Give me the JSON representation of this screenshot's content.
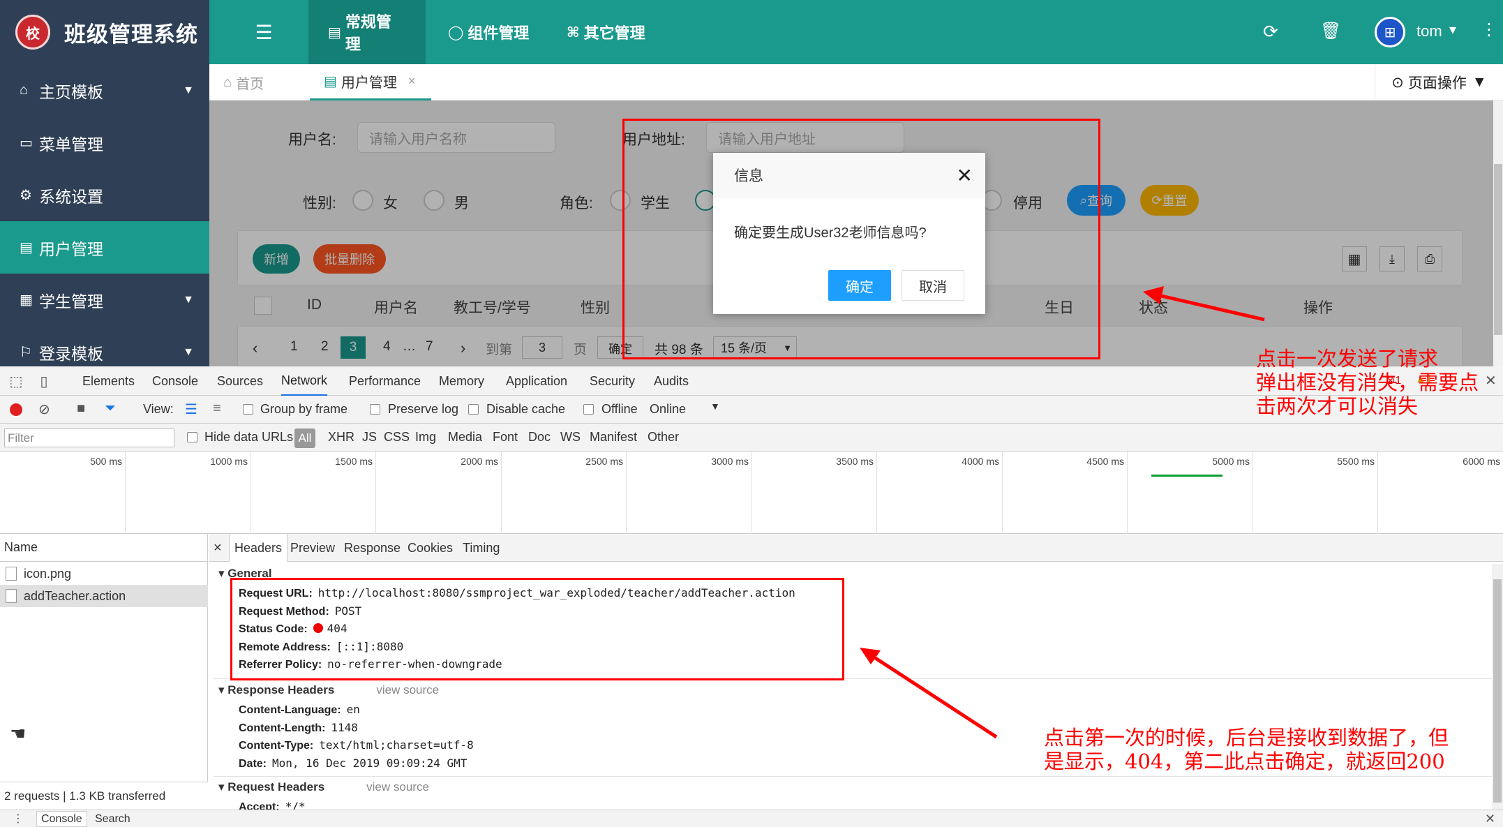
{
  "app": {
    "title": "班级管理系统",
    "logo_text": "校"
  },
  "topnav": [
    {
      "label": "常规管理",
      "icon": "file-icon"
    },
    {
      "label": "组件管理",
      "icon": "lemon-icon"
    },
    {
      "label": "其它管理",
      "icon": "slideshare-icon"
    }
  ],
  "topright": {
    "user": "tom"
  },
  "sidebar": [
    {
      "label": "主页模板",
      "icon": "home-icon"
    },
    {
      "label": "菜单管理",
      "icon": "window-icon"
    },
    {
      "label": "系统设置",
      "icon": "gears-icon"
    },
    {
      "label": "用户管理",
      "icon": "file-icon"
    },
    {
      "label": "学生管理",
      "icon": "calendar-icon"
    },
    {
      "label": "登录模板",
      "icon": "flag-icon"
    }
  ],
  "tabs": {
    "home": "首页",
    "users": "用户管理",
    "page_ops": "页面操作"
  },
  "search": {
    "username_label": "用户名:",
    "username_placeholder": "请输入用户名称",
    "address_label": "用户地址:",
    "address_placeholder": "请输入用户地址",
    "gender_label": "性别:",
    "female": "女",
    "male": "男",
    "role_label": "角色:",
    "student": "学生",
    "disabled": "停用",
    "query_btn": "查询",
    "reset_btn": "重置"
  },
  "table_toolbar": {
    "add": "新增",
    "batch_delete": "批量删除"
  },
  "table_headers": [
    "ID",
    "用户名",
    "教工号/学号",
    "性别",
    "生日",
    "状态",
    "操作"
  ],
  "pagination": {
    "pages": [
      "1",
      "2",
      "3",
      "4",
      "…",
      "7"
    ],
    "current": "3",
    "goto_label": "到第",
    "goto_value": "3",
    "page_unit": "页",
    "confirm": "确定",
    "total": "共 98 条",
    "per_page": "15 条/页"
  },
  "modal": {
    "title": "信息",
    "message": "确定要生成User32老师信息吗?",
    "ok": "确定",
    "cancel": "取消"
  },
  "annotations": {
    "top_note": [
      "点击一次发送了请求",
      "弹出框没有消失，需要点",
      "击两次才可以消失"
    ],
    "bottom_note": [
      "点击第一次的时候，后台是接收到数据了，但",
      "是显示，404，第二此点击确定，就返回200"
    ]
  },
  "devtools": {
    "tabs": [
      "Elements",
      "Console",
      "Sources",
      "Network",
      "Performance",
      "Memory",
      "Application",
      "Security",
      "Audits"
    ],
    "errors": "1",
    "warnings": "1",
    "view_label": "View:",
    "group_by_frame": "Group by frame",
    "preserve_log": "Preserve log",
    "disable_cache": "Disable cache",
    "offline": "Offline",
    "online": "Online",
    "filter_placeholder": "Filter",
    "hide_data_urls": "Hide data URLs",
    "filter_types": [
      "All",
      "XHR",
      "JS",
      "CSS",
      "Img",
      "Media",
      "Font",
      "Doc",
      "WS",
      "Manifest",
      "Other"
    ],
    "timeline_ticks": [
      "500 ms",
      "1000 ms",
      "1500 ms",
      "2000 ms",
      "2500 ms",
      "3000 ms",
      "3500 ms",
      "4000 ms",
      "4500 ms",
      "5000 ms",
      "5500 ms",
      "6000 ms"
    ],
    "name_header": "Name",
    "requests": [
      "icon.png",
      "addTeacher.action"
    ],
    "footer": "2 requests  |  1.3 KB transferred",
    "detail_tabs": [
      "Headers",
      "Preview",
      "Response",
      "Cookies",
      "Timing"
    ],
    "general_title": "General",
    "general": [
      {
        "k": "Request URL:",
        "v": "http://localhost:8080/ssmproject_war_exploded/teacher/addTeacher.action"
      },
      {
        "k": "Request Method:",
        "v": "POST"
      },
      {
        "k": "Status Code:",
        "v": "404"
      },
      {
        "k": "Remote Address:",
        "v": "[::1]:8080"
      },
      {
        "k": "Referrer Policy:",
        "v": "no-referrer-when-downgrade"
      }
    ],
    "response_headers_title": "Response Headers",
    "view_source": "view source",
    "response_headers": [
      {
        "k": "Content-Language:",
        "v": "en"
      },
      {
        "k": "Content-Length:",
        "v": "1148"
      },
      {
        "k": "Content-Type:",
        "v": "text/html;charset=utf-8"
      },
      {
        "k": "Date:",
        "v": "Mon, 16 Dec 2019 09:09:24 GMT"
      }
    ],
    "request_headers_title": "Request Headers",
    "request_first": {
      "k": "Accept:",
      "v": "*/*"
    },
    "bottom_tabs": [
      "Console",
      "Search"
    ]
  }
}
